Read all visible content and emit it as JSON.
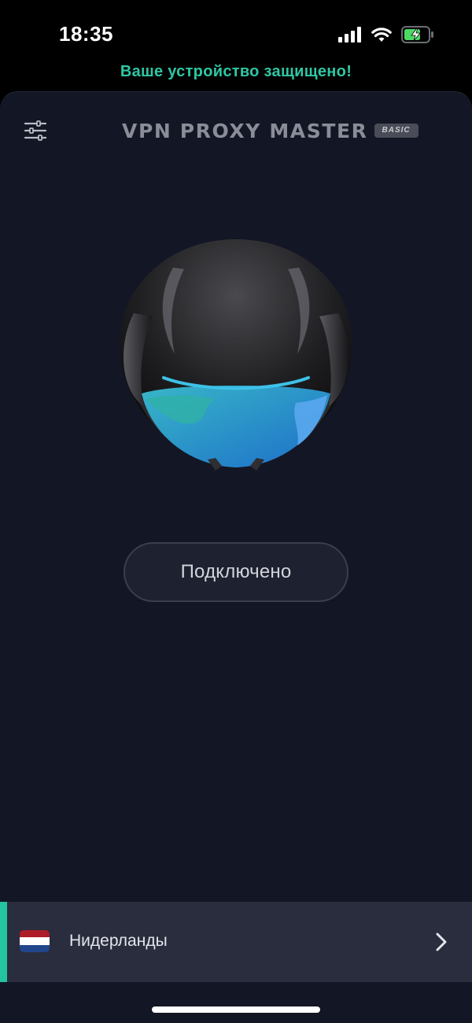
{
  "status_bar": {
    "time": "18:35",
    "signal_icon": "cellular-signal-icon",
    "wifi_icon": "wifi-icon",
    "battery_icon": "battery-charging-icon",
    "battery_color": "#4cd964"
  },
  "banner": {
    "text": "Ваше устройство защищено!",
    "color": "#2ec7a4"
  },
  "header": {
    "menu_icon": "settings-sliders-icon",
    "logo_text": "VPN PROXY MASTER",
    "badge": "BASIC"
  },
  "main": {
    "helmet_icon": "helmet-globe-icon",
    "connection_status": "Подключено"
  },
  "location": {
    "country": "Нидерланды",
    "flag_icon": "netherlands-flag-icon",
    "flag_colors": [
      "#ae1c28",
      "#ffffff",
      "#21468b"
    ],
    "chevron_icon": "chevron-right-icon",
    "accent_color": "#25c4a0"
  }
}
